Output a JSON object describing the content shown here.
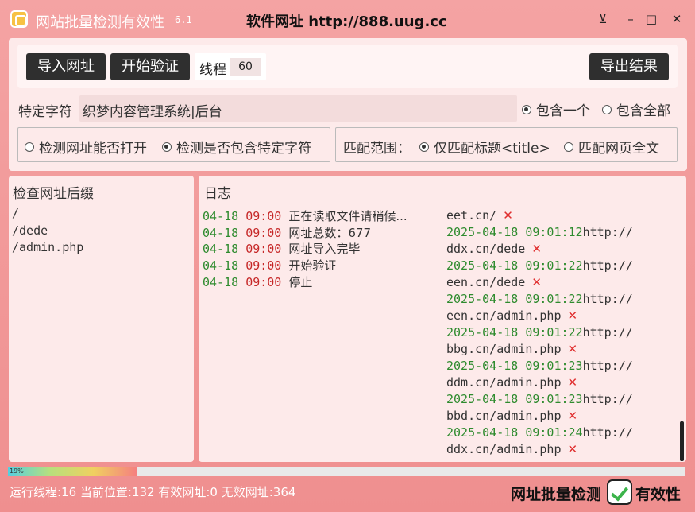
{
  "app": {
    "title": "网站批量检测有效性",
    "version": "6.1",
    "site": "软件网址  http://888.uug.cc",
    "icons": {
      "window": "app-icon",
      "pin": "pin-icon",
      "minimize": "minimize-icon",
      "maximize": "maximize-icon",
      "close": "close-icon"
    }
  },
  "window_controls": {
    "pin": "⊻",
    "minimize": "–",
    "maximize": "□",
    "close": "✕"
  },
  "toolbar": {
    "import": "导入网址",
    "start": "开始验证",
    "threads_label": "线程",
    "threads_value": "60",
    "export": "导出结果"
  },
  "filter": {
    "label": "特定字符",
    "value": "织梦内容管理系统|后台",
    "opt_one": "包含一个",
    "opt_all": "包含全部",
    "selected": "包含一个"
  },
  "mode": {
    "opt_open": "检测网址能否打开",
    "opt_contains": "检测是否包含特定字符",
    "selected": "检测是否包含特定字符"
  },
  "range": {
    "label": "匹配范围：",
    "opt_title": "仅匹配标题<title>",
    "opt_full": "匹配网页全文",
    "selected": "仅匹配标题<title>"
  },
  "suffix_pane": {
    "title": "检查网址后缀",
    "items": [
      "/",
      "/dede",
      "/admin.php"
    ]
  },
  "log_pane": {
    "title": "日志",
    "lines": [
      {
        "date": "04-18",
        "time": "09:00",
        "msg": "正在读取文件请稍候..."
      },
      {
        "date": "04-18",
        "time": "09:00",
        "msg": "网址总数：677"
      },
      {
        "date": "04-18",
        "time": "09:00",
        "msg": "网址导入完毕"
      },
      {
        "date": "04-18",
        "time": "09:00",
        "msg": "开始验证"
      },
      {
        "date": "04-18",
        "time": "09:00",
        "msg": "停止"
      }
    ],
    "results": [
      {
        "url_tail": "eet.cn/",
        "mark": "✕"
      },
      {
        "ts": "2025-04-18 09:01:12",
        "prefix": "http://",
        "url_tail": "ddx.cn/dede",
        "mark": "✕"
      },
      {
        "ts": "2025-04-18 09:01:22",
        "prefix": "http://",
        "url_tail": "een.cn/dede",
        "mark": "✕"
      },
      {
        "ts": "2025-04-18 09:01:22",
        "prefix": "http://",
        "url_tail": "een.cn/admin.php",
        "mark": "✕"
      },
      {
        "ts": "2025-04-18 09:01:22",
        "prefix": "http://",
        "url_tail": "bbg.cn/admin.php",
        "mark": "✕"
      },
      {
        "ts": "2025-04-18 09:01:23",
        "prefix": "http://",
        "url_tail": "ddm.cn/admin.php",
        "mark": "✕"
      },
      {
        "ts": "2025-04-18 09:01:23",
        "prefix": "http://",
        "url_tail": "bbd.cn/admin.php",
        "mark": "✕"
      },
      {
        "ts": "2025-04-18 09:01:24",
        "prefix": "http://",
        "url_tail": "ddx.cn/admin.php",
        "mark": "✕"
      }
    ]
  },
  "progress": {
    "percent_label": "19%",
    "fraction": 0.19
  },
  "status": {
    "text": "运行线程:16 当前位置:132 有效网址:0 无效网址:364"
  },
  "brand": {
    "left": "网址批量检测",
    "right": "有效性"
  }
}
